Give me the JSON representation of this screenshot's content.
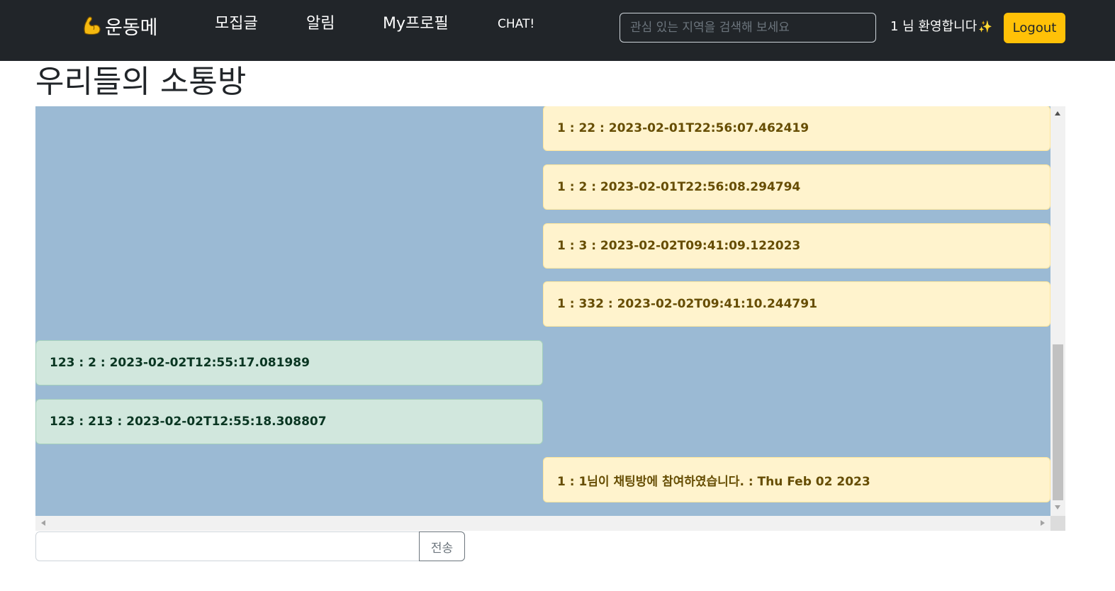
{
  "navbar": {
    "brand": "운동메",
    "brand_icon": "flexed-biceps-icon",
    "links": [
      "모집글",
      "알림",
      "My프로필",
      "CHAT!"
    ],
    "search_placeholder": "관심 있는 지역을 검색해 보세요",
    "welcome": "1 님 환영합니다",
    "welcome_icon": "sparkles-icon",
    "logout_label": "Logout"
  },
  "page": {
    "title": "우리들의 소통방"
  },
  "chat": {
    "background": "#9bbad4",
    "messages": [
      {
        "side": "mine",
        "text": "1 : 22 : 2023-02-01T22:56:07.462419"
      },
      {
        "side": "mine",
        "text": "1 : 2 : 2023-02-01T22:56:08.294794"
      },
      {
        "side": "mine",
        "text": "1 : 3 : 2023-02-02T09:41:09.122023"
      },
      {
        "side": "mine",
        "text": "1 : 332 : 2023-02-02T09:41:10.244791"
      },
      {
        "side": "other",
        "text": "123 : 2 : 2023-02-02T12:55:17.081989"
      },
      {
        "side": "other",
        "text": "123 : 213 : 2023-02-02T12:55:18.308807"
      },
      {
        "side": "mine",
        "text": "1 : 1님이 채팅방에 참여하였습니다. : Thu Feb 02 2023"
      }
    ]
  },
  "composer": {
    "input_value": "",
    "send_label": "전송"
  },
  "colors": {
    "navbar": "#212529",
    "logout": "#ffc107",
    "mine_bubble": "#fff3cd",
    "other_bubble": "#d1e7dd"
  }
}
